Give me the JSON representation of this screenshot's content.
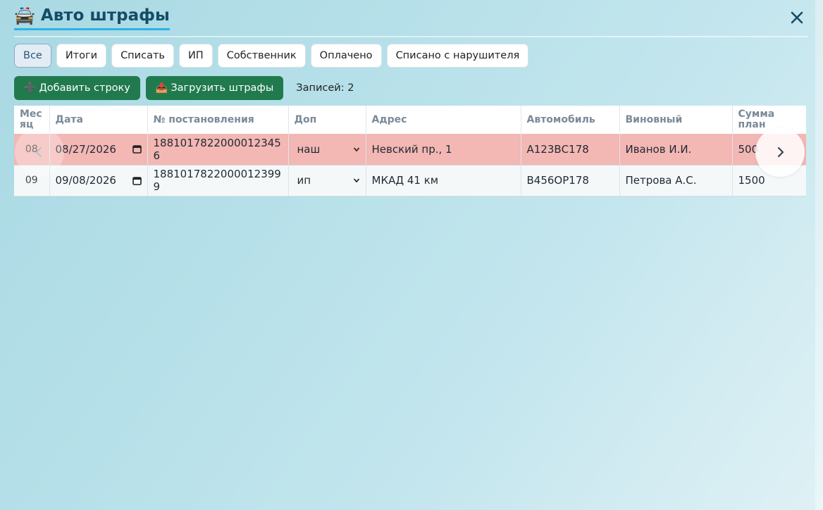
{
  "header": {
    "icon": "police-car-icon",
    "title": "Авто штрафы"
  },
  "tabs": [
    {
      "label": "Все",
      "active": true
    },
    {
      "label": "Итоги",
      "active": false
    },
    {
      "label": "Списать",
      "active": false
    },
    {
      "label": "ИП",
      "active": false
    },
    {
      "label": "Собственник",
      "active": false
    },
    {
      "label": "Оплачено",
      "active": false
    },
    {
      "label": "Списано с нарушителя",
      "active": false
    }
  ],
  "toolbar": {
    "add_label": "Добавить строку",
    "add_icon": "➕",
    "upload_label": "Загрузить штрафы",
    "upload_icon": "📤",
    "count_label": "Записей: 2"
  },
  "table": {
    "headers": {
      "month": "Мес яц",
      "date": "Дата",
      "number": "№ постановления",
      "extra": "Доп",
      "address": "Адрес",
      "car": "Автомобиль",
      "culprit": "Виновный",
      "sum": "Сумма план"
    },
    "rows": [
      {
        "month": "08",
        "date": "08/27/2026",
        "number": "18810178220000123456",
        "extra": "наш",
        "address": "Невский пр., 1",
        "car": "А123ВС178",
        "culprit": "Иванов И.И.",
        "sum": "500",
        "highlight": "#f3b7b4"
      },
      {
        "month": "09",
        "date": "09/08/2026",
        "number": "18810178220000123999",
        "extra": "ип",
        "address": "МКАД 41 км",
        "car": "В456ОР178",
        "culprit": "Петрова А.С.",
        "sum": "1500",
        "highlight": ""
      }
    ]
  },
  "colors": {
    "accent": "#2bb3e6",
    "title": "#134d66",
    "button_green": "#207a4d",
    "row_highlight": "#f3b7b4"
  }
}
